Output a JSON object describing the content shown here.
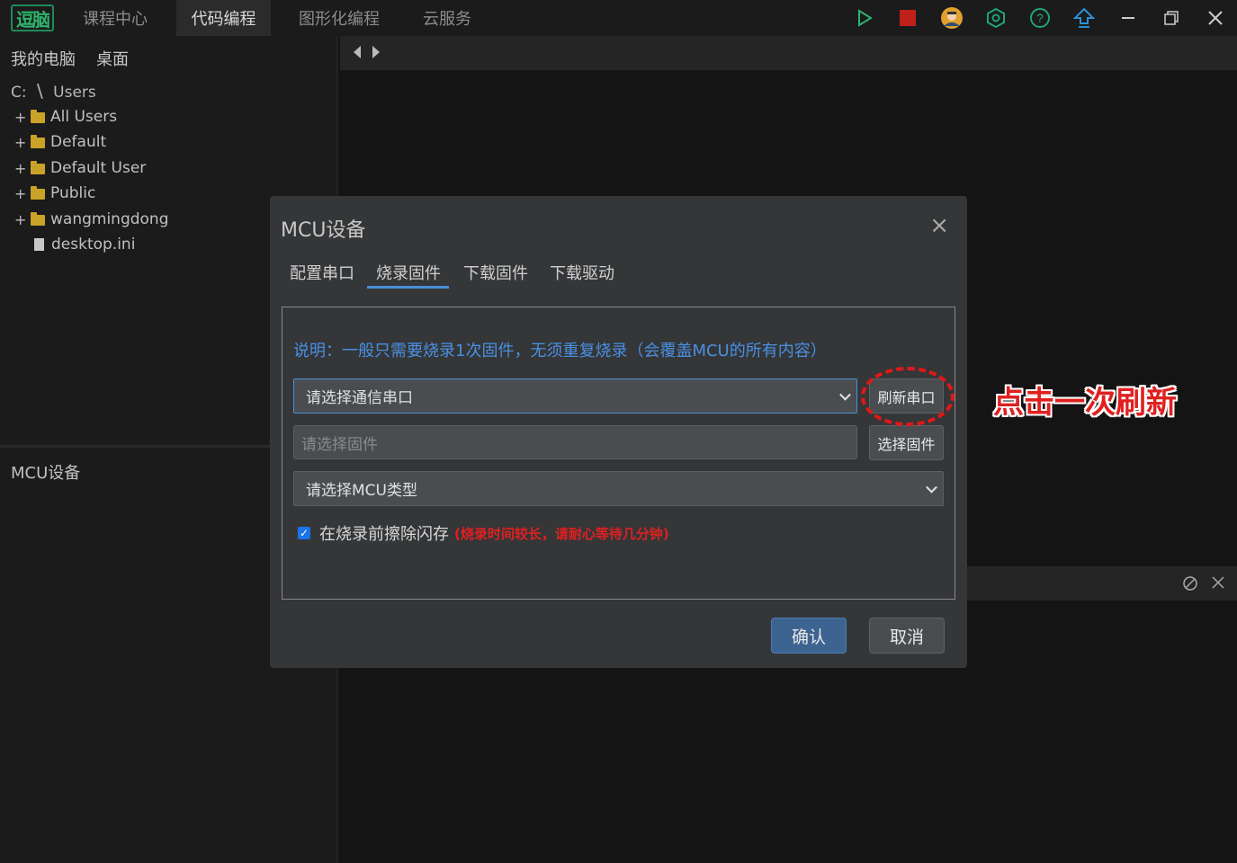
{
  "topbar": {
    "logo_text": "逗脑",
    "nav": [
      "课程中心",
      "代码编程",
      "图形化编程",
      "云服务"
    ],
    "active_nav": "代码编程",
    "icons": [
      "play-icon",
      "stop-icon",
      "user-avatar-icon",
      "gear-hex-icon",
      "help-icon",
      "upload-icon",
      "minimize-icon",
      "restore-icon",
      "close-icon"
    ],
    "colors": {
      "play": "#2fb36e",
      "stop": "#c0201a",
      "accent_teal": "#1fa37a",
      "upload": "#2d8fd6"
    }
  },
  "sidebar": {
    "tabs": [
      "我的电脑",
      "桌面"
    ],
    "path": {
      "drive": "C:",
      "separator": "\\",
      "folder": "Users"
    },
    "tree": [
      {
        "type": "folder",
        "label": "All Users"
      },
      {
        "type": "folder",
        "label": "Default"
      },
      {
        "type": "folder",
        "label": "Default User"
      },
      {
        "type": "folder",
        "label": "Public"
      },
      {
        "type": "folder",
        "label": "wangmingdong"
      },
      {
        "type": "file",
        "label": "desktop.ini"
      }
    ],
    "bottom_title": "MCU设备"
  },
  "dialog": {
    "title": "MCU设备",
    "close": "×",
    "tabs": [
      "配置串口",
      "烧录固件",
      "下载固件",
      "下载驱动"
    ],
    "active_tab": "烧录固件",
    "description": "说明：一般只需要烧录1次固件，无须重复烧录（会覆盖MCU的所有内容）",
    "port_select": "请选择通信串口",
    "refresh_button": "刷新串口",
    "firmware_placeholder": "请选择固件",
    "choose_firmware_button": "选择固件",
    "mcu_type_select": "请选择MCU类型",
    "erase_checkbox": {
      "checked": true,
      "label": "在烧录前擦除闪存",
      "warning": "(烧录时间较长，请耐心等待几分钟)"
    },
    "confirm": "确认",
    "cancel": "取消"
  },
  "annotation": {
    "text": "点击一次刷新",
    "color": "#e02020"
  }
}
